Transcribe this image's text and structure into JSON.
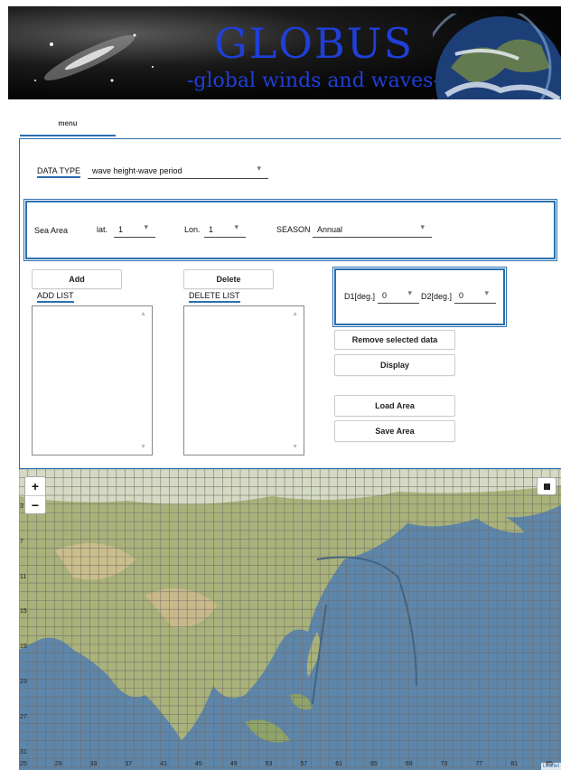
{
  "banner": {
    "title": "GLOBUS",
    "subtitle": "-global winds and waves-"
  },
  "tabs": [
    {
      "label": "menu"
    }
  ],
  "data_type": {
    "label": "DATA TYPE",
    "value": "wave height-wave period"
  },
  "sea_area": {
    "label": "Sea Area",
    "lat_label": "lat.",
    "lat_value": "1",
    "lon_label": "Lon.",
    "lon_value": "1",
    "season_label": "SEASON",
    "season_value": "Annual"
  },
  "buttons": {
    "add": "Add",
    "delete": "Delete",
    "remove_selected": "Remove selected data",
    "display": "Display",
    "load_area": "Load Area",
    "save_area": "Save Area"
  },
  "lists": {
    "add_list_label": "ADD LIST",
    "delete_list_label": "DELETE LIST"
  },
  "degrees": {
    "d1_label": "D1[deg.]",
    "d1_value": "0",
    "d2_label": "D2[deg.]",
    "d2_value": "0"
  },
  "map": {
    "zoom_in": "+",
    "zoom_out": "−",
    "lat_ticks": [
      "3",
      "7",
      "11",
      "15",
      "19",
      "23",
      "27",
      "31"
    ],
    "lon_ticks": [
      "25",
      "29",
      "33",
      "37",
      "41",
      "45",
      "49",
      "53",
      "57",
      "61",
      "65",
      "69",
      "73",
      "77",
      "81",
      "85"
    ],
    "attribution": "Leaflet"
  },
  "colors": {
    "accent": "#2a6fb0",
    "banner_text": "#1f3fd6",
    "ocean": "#5e86aa",
    "land": "#a8b27a"
  }
}
